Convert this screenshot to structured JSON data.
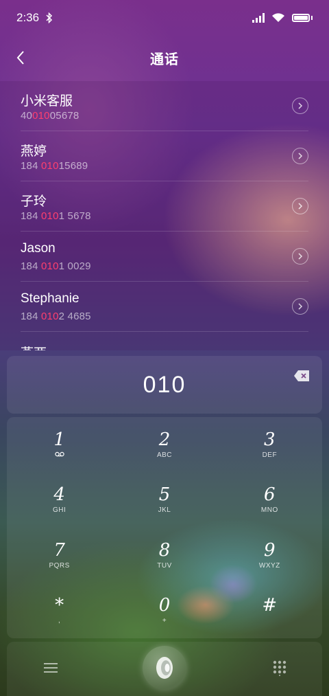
{
  "status_bar": {
    "time": "2:36",
    "bluetooth_icon": "bluetooth-icon",
    "signal_icon": "signal-icon",
    "wifi_icon": "wifi-icon",
    "battery_icon": "battery-icon"
  },
  "header": {
    "back_icon": "chevron-left-icon",
    "title": "通话"
  },
  "contacts": [
    {
      "name": "小米客服",
      "number_before": "40",
      "number_match": "010",
      "number_after": "05678"
    },
    {
      "name": "燕婷",
      "number_before": "184 ",
      "number_match": "010",
      "number_after": "15689"
    },
    {
      "name": "子玲",
      "number_before": "184 ",
      "number_match": "010",
      "number_after": "1 5678"
    },
    {
      "name": "Jason",
      "number_before": "184 ",
      "number_match": "010",
      "number_after": "1 0029"
    },
    {
      "name": "Stephanie",
      "number_before": "184 ",
      "number_match": "010",
      "number_after": "2 4685"
    },
    {
      "name": "燕两"
    }
  ],
  "highlight_color": "#ff3f6e",
  "dialer": {
    "number": "010",
    "backspace_icon": "backspace-icon"
  },
  "keypad": [
    {
      "digit": "1",
      "sub": "voicemail-icon"
    },
    {
      "digit": "2",
      "sub": "ABC"
    },
    {
      "digit": "3",
      "sub": "DEF"
    },
    {
      "digit": "4",
      "sub": "GHI"
    },
    {
      "digit": "5",
      "sub": "JKL"
    },
    {
      "digit": "6",
      "sub": "MNO"
    },
    {
      "digit": "7",
      "sub": "PQRS"
    },
    {
      "digit": "8",
      "sub": "TUV"
    },
    {
      "digit": "9",
      "sub": "WXYZ"
    },
    {
      "digit": "*",
      "sub": ","
    },
    {
      "digit": "0",
      "sub": "+"
    },
    {
      "digit": "#",
      "sub": ""
    }
  ],
  "bottom_bar": {
    "menu_icon": "menu-icon",
    "call_icon": "call-icon",
    "dialpad_icon": "dialpad-icon"
  }
}
